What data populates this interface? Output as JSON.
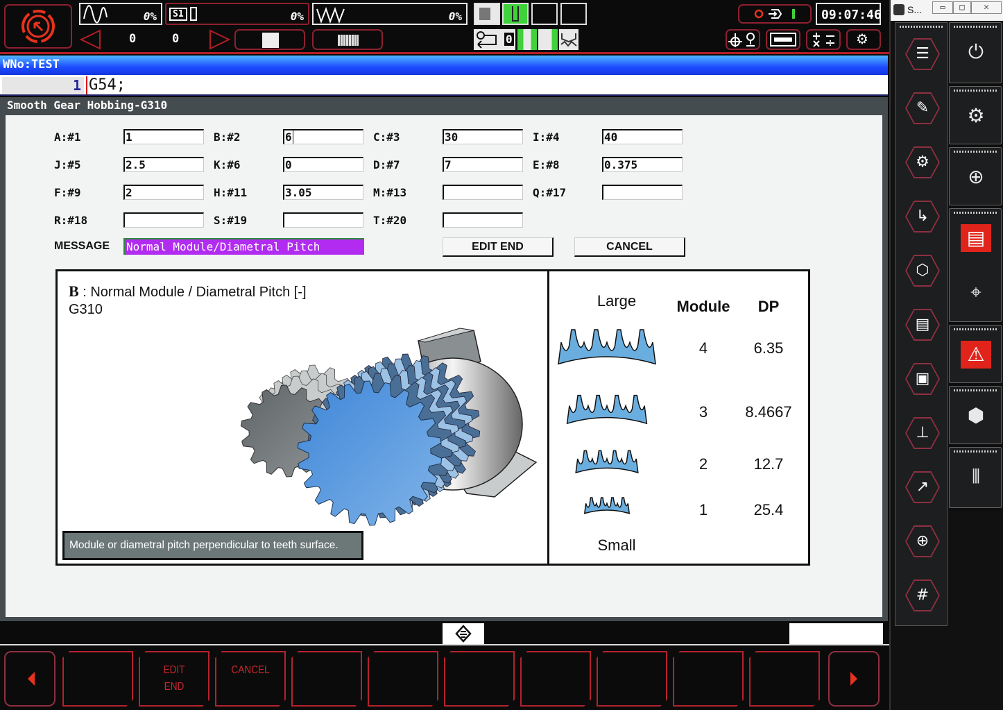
{
  "topbar": {
    "spindle_load_pct": "0%",
    "spindle_label": "S1",
    "spindle_pct": "0%",
    "feed_pct": "0%",
    "counter_left": "0",
    "counter_right": "0",
    "return_count": "0",
    "clock": "09:07:46"
  },
  "wno": {
    "label": "WNo:TEST"
  },
  "program": {
    "line_number": "1",
    "code": "G54;"
  },
  "panel": {
    "title": "Smooth Gear Hobbing-G310"
  },
  "form": {
    "fields": [
      {
        "label": "A:#1",
        "value": "1"
      },
      {
        "label": "B:#2",
        "value": "6"
      },
      {
        "label": "C:#3",
        "value": "30"
      },
      {
        "label": "I:#4",
        "value": "40"
      },
      {
        "label": "J:#5",
        "value": "2.5"
      },
      {
        "label": "K:#6",
        "value": "0"
      },
      {
        "label": "D:#7",
        "value": "7"
      },
      {
        "label": "E:#8",
        "value": "0.375"
      },
      {
        "label": "F:#9",
        "value": "2"
      },
      {
        "label": "H:#11",
        "value": "3.05"
      },
      {
        "label": "M:#13",
        "value": ""
      },
      {
        "label": "Q:#17",
        "value": ""
      },
      {
        "label": "R:#18",
        "value": ""
      },
      {
        "label": "S:#19",
        "value": ""
      },
      {
        "label": "T:#20",
        "value": ""
      }
    ],
    "message_label": "MESSAGE",
    "message_value": "Normal Module/Diametral Pitch",
    "edit_end_button": "EDIT END",
    "cancel_button": "CANCEL"
  },
  "help": {
    "title_letter": "B",
    "title_text": " : Normal Module / Diametral Pitch [-]",
    "subtitle": "G310",
    "caption": "Module or diametral pitch perpendicular  to teeth surface.",
    "table": {
      "large_label": "Large",
      "small_label": "Small",
      "col_module": "Module",
      "col_dp": "DP",
      "rows": [
        {
          "module": "4",
          "dp": "6.35"
        },
        {
          "module": "3",
          "dp": "8.4667"
        },
        {
          "module": "2",
          "dp": "12.7"
        },
        {
          "module": "1",
          "dp": "25.4"
        }
      ]
    },
    "colors": {
      "gear_blue": "#6aaee0",
      "gear_gray": "#7a7f82"
    }
  },
  "softkeys": [
    {
      "label": ""
    },
    {
      "label": "EDIT\nEND"
    },
    {
      "label": "CANCEL"
    },
    {
      "label": ""
    },
    {
      "label": ""
    },
    {
      "label": ""
    },
    {
      "label": ""
    },
    {
      "label": ""
    },
    {
      "label": ""
    },
    {
      "label": ""
    }
  ],
  "sidebar": {
    "window_title": "S...",
    "left_icons": [
      "parameter-sliders",
      "program-edit",
      "program-settings",
      "path",
      "3d-view",
      "tool-data",
      "tool-folder",
      "coordinate-system",
      "3d-coordinate",
      "measurement",
      "macro-variables"
    ],
    "right_icons": [
      "power",
      "settings",
      "workpiece-origin",
      "program-list",
      "tool-path-check",
      "alarm",
      "tool-setting",
      "spindle-1-2"
    ]
  },
  "colors": {
    "accent_red": "#b21d24",
    "wno_blue": "#1d4bff",
    "message_purple": "#b12cf0",
    "status_green": "#3fd23a"
  }
}
